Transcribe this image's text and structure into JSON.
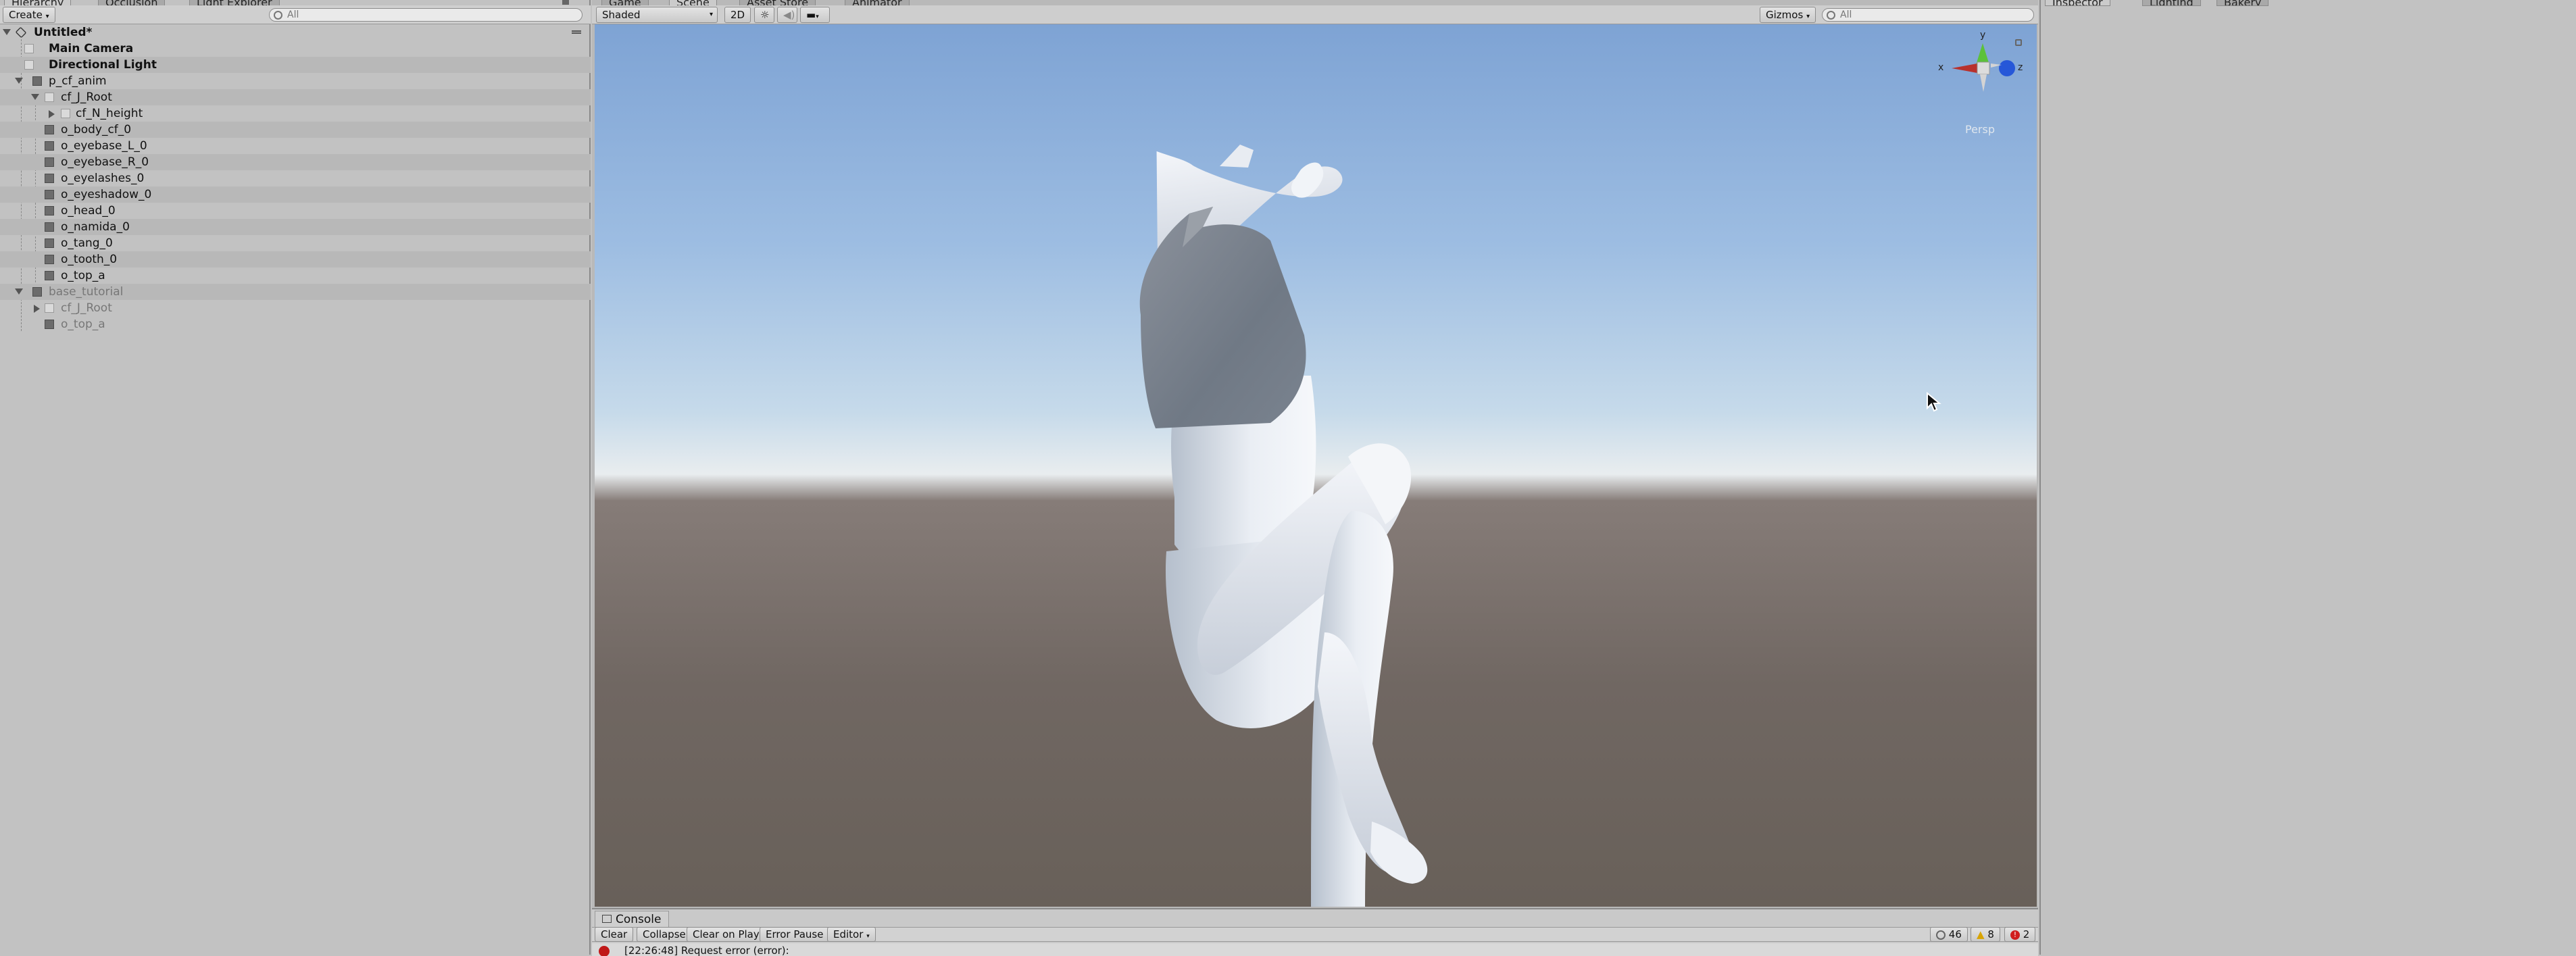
{
  "hierarchy": {
    "tabs": [
      "Hierarchy",
      "Occlusion",
      "Light Explorer"
    ],
    "create_label": "Create",
    "search_placeholder": "All",
    "scene_name": "Untitled*",
    "items": [
      {
        "label": "Main Camera",
        "depth": 1,
        "style": "bold"
      },
      {
        "label": "Directional Light",
        "depth": 1,
        "style": "bold"
      },
      {
        "label": "p_cf_anim",
        "depth": 0,
        "style": "normal"
      },
      {
        "label": "cf_J_Root",
        "depth": 1,
        "style": "normal"
      },
      {
        "label": "cf_N_height",
        "depth": 2,
        "style": "normal"
      },
      {
        "label": "o_body_cf_0",
        "depth": 1,
        "style": "normal"
      },
      {
        "label": "o_eyebase_L_0",
        "depth": 1,
        "style": "normal"
      },
      {
        "label": "o_eyebase_R_0",
        "depth": 1,
        "style": "normal"
      },
      {
        "label": "o_eyelashes_0",
        "depth": 1,
        "style": "normal"
      },
      {
        "label": "o_eyeshadow_0",
        "depth": 1,
        "style": "normal"
      },
      {
        "label": "o_head_0",
        "depth": 1,
        "style": "normal"
      },
      {
        "label": "o_namida_0",
        "depth": 1,
        "style": "normal"
      },
      {
        "label": "o_tang_0",
        "depth": 1,
        "style": "normal"
      },
      {
        "label": "o_tooth_0",
        "depth": 1,
        "style": "normal"
      },
      {
        "label": "o_top_a",
        "depth": 1,
        "style": "normal"
      },
      {
        "label": "base_tutorial",
        "depth": 0,
        "style": "greyed"
      },
      {
        "label": "cf_J_Root",
        "depth": 1,
        "style": "greyed"
      },
      {
        "label": "o_top_a",
        "depth": 1,
        "style": "greyed"
      }
    ]
  },
  "scene": {
    "tabs": [
      "Game",
      "Scene",
      "Asset Store",
      "Animator"
    ],
    "shading_mode": "Shaded",
    "mode_2d": "2D",
    "gizmos_label": "Gizmos",
    "search_placeholder": "All",
    "axis_labels": {
      "y": "y",
      "x": "x",
      "z": "z"
    },
    "projection_label": "Persp"
  },
  "console": {
    "tab_label": "Console",
    "buttons": [
      "Clear",
      "Collapse",
      "Clear on Play",
      "Error Pause",
      "Editor"
    ],
    "counts": {
      "info": "46",
      "warning": "8",
      "error": "2"
    },
    "last_message": "[22:26:48] Request error (error):"
  },
  "inspector": {
    "tabs": [
      "Inspector",
      "Lighting",
      "Bakery"
    ]
  },
  "colors": {
    "editor_bg": "#c2c2c2",
    "sky_top": "#7ea3d4",
    "ground": "#6f6660",
    "model": "#eef2f8"
  }
}
